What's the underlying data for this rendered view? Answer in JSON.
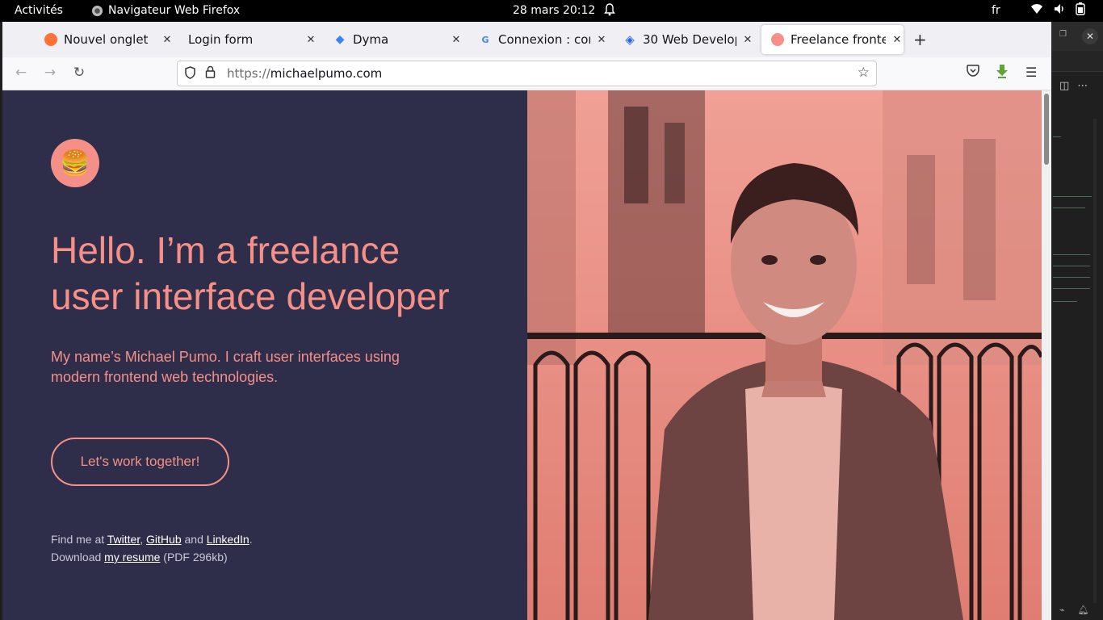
{
  "topbar": {
    "activities": "Activités",
    "app_name": "Navigateur Web Firefox",
    "clock": "28 mars  20:12",
    "lang": "fr"
  },
  "tabs": [
    {
      "label": "Nouvel onglet",
      "icon": "firefox-icon",
      "color": "#ff7139"
    },
    {
      "label": "Login form",
      "icon": "none",
      "color": ""
    },
    {
      "label": "Dyma",
      "icon": "dyma-icon",
      "color": "#3b82f6"
    },
    {
      "label": "Connexion : com",
      "icon": "google-icon",
      "color": "#4285f4"
    },
    {
      "label": "30 Web Develop",
      "icon": "diamond-icon",
      "color": "#2563eb"
    },
    {
      "label": "Freelance fronte",
      "icon": "circle-icon",
      "color": "#f59089",
      "active": true
    }
  ],
  "urlbar": {
    "protocol": "https://",
    "domain": "michaelpumo.com"
  },
  "page": {
    "logo": "🍔",
    "hero_line1": "Hello. I’m a freelance",
    "hero_line2": "user interface developer",
    "intro": "My name’s Michael Pumo. I craft user interfaces using modern frontend web technologies.",
    "cta": "Let's work together!",
    "find_prefix": "Find me at ",
    "twitter": "Twitter",
    "comma": ", ",
    "github": "GitHub",
    "and": " and ",
    "linkedin": "LinkedIn",
    "period": ".",
    "download_prefix": "Download ",
    "resume": "my resume",
    "resume_meta": " (PDF 296kb)"
  },
  "colors": {
    "accent": "#f59089",
    "background": "#2e2d4a"
  }
}
